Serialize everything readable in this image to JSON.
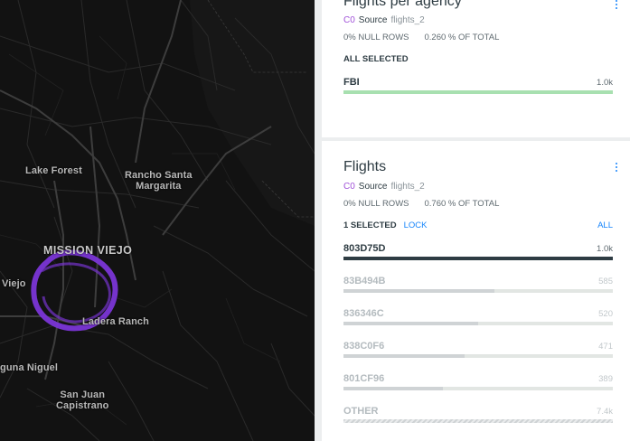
{
  "map": {
    "labels": {
      "lake_forest": "Lake Forest",
      "rancho_santa_margarita": "Rancho Santa\nMargarita",
      "mission_viejo": "MISSION VIEJO",
      "aliso_viejo": "Viejo",
      "ladera_ranch": "Ladera Ranch",
      "laguna_niguel": "guna Niguel",
      "san_juan_capistrano": "San Juan\nCapistrano"
    },
    "flight_path_color": "#7b35d6"
  },
  "widgets": [
    {
      "title": "Flights per agency",
      "source_tag": "C0",
      "source_label": "Source",
      "source_name": "flights_2",
      "null_rows": "0% NULL ROWS",
      "pct_total": "0.260 % OF TOTAL",
      "selection": "ALL SELECTED",
      "categories": [
        {
          "name": "FBI",
          "value_label": "1.0k",
          "fraction": 1.0
        }
      ]
    },
    {
      "title": "Flights",
      "source_tag": "C0",
      "source_label": "Source",
      "source_name": "flights_2",
      "null_rows": "0% NULL ROWS",
      "pct_total": "0.760 % OF TOTAL",
      "selection": "1 SELECTED",
      "lock_label": "LOCK",
      "all_label": "ALL",
      "categories": [
        {
          "name": "803D75D",
          "value_label": "1.0k",
          "fraction": 1.0,
          "state": "selected"
        },
        {
          "name": "83B494B",
          "value_label": "585",
          "fraction": 0.56,
          "state": "muted"
        },
        {
          "name": "836346C",
          "value_label": "520",
          "fraction": 0.5,
          "state": "muted"
        },
        {
          "name": "838C0F6",
          "value_label": "471",
          "fraction": 0.45,
          "state": "muted"
        },
        {
          "name": "801CF96",
          "value_label": "389",
          "fraction": 0.37,
          "state": "muted"
        },
        {
          "name": "OTHER",
          "value_label": "7.4k",
          "fraction": 1.0,
          "state": "other"
        }
      ]
    }
  ],
  "colors": {
    "accent": "#1785fb",
    "source_tag": "#a050d8",
    "bar_green": "#a8e0b0",
    "bar_selected": "#2e3c43",
    "bar_muted": "#cfd3d5"
  }
}
